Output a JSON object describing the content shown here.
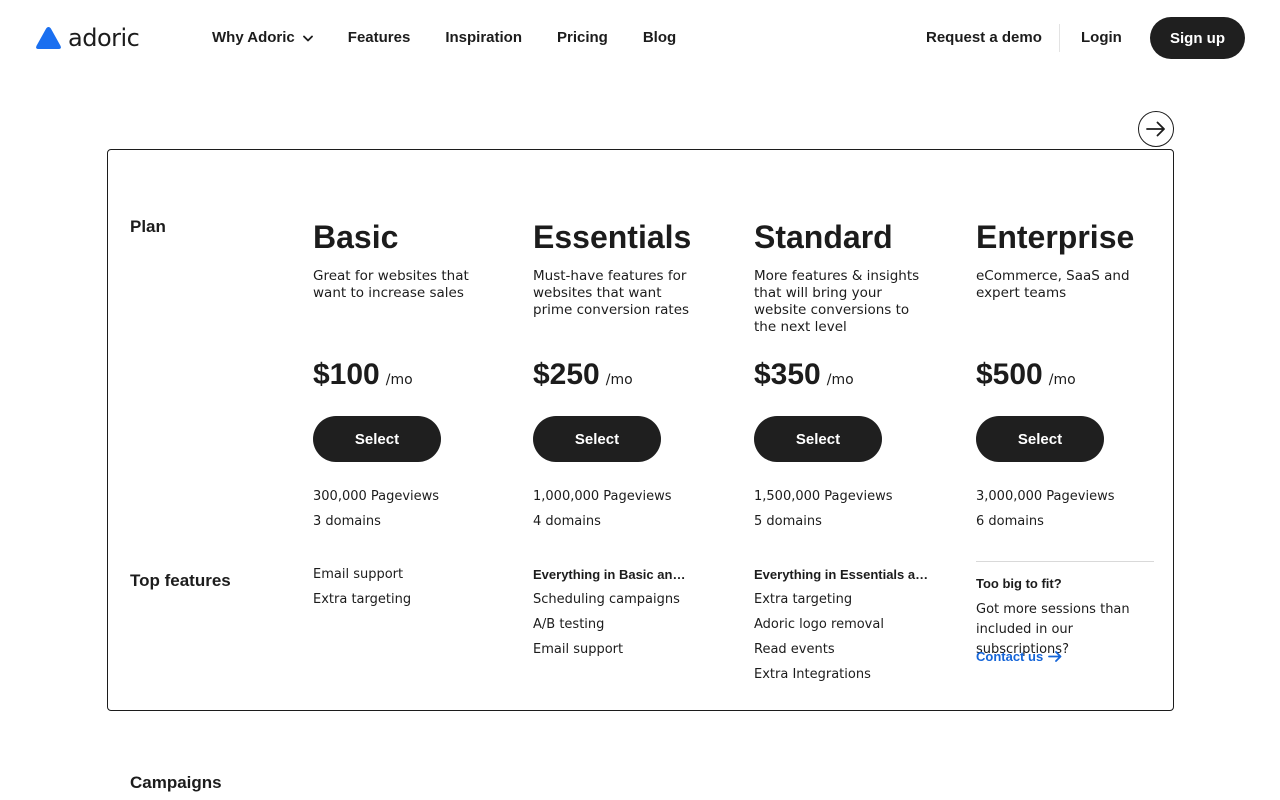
{
  "header": {
    "brand": "adoric",
    "nav": [
      {
        "label": "Why Adoric",
        "has_dropdown": true
      },
      {
        "label": "Features"
      },
      {
        "label": "Inspiration"
      },
      {
        "label": "Pricing"
      },
      {
        "label": "Blog"
      }
    ],
    "request_demo": "Request a demo",
    "login": "Login",
    "signup": "Sign up"
  },
  "colors": {
    "brand_blue": "#1a6ff0",
    "button_dark": "#1f1f1f",
    "link_blue": "#1565d8"
  },
  "pricing": {
    "plan_row_label": "Plan",
    "features_row_label": "Top features",
    "plans": [
      {
        "name": "Basic",
        "description": "Great for websites that want to increase sales",
        "price": "$100",
        "period": "/mo",
        "cta": "Select",
        "pageviews": "300,000 Pageviews",
        "domains": "3 domains",
        "features_heading": "",
        "features": [
          "Email support",
          "Extra targeting"
        ]
      },
      {
        "name": "Essentials",
        "description": "Must-have features for websites that want prime conversion rates",
        "price": "$250",
        "period": "/mo",
        "cta": "Select",
        "pageviews": "1,000,000 Pageviews",
        "domains": "4 domains",
        "features_heading": "Everything in Basic and...",
        "features": [
          "Scheduling campaigns",
          "A/B testing",
          "Email support"
        ]
      },
      {
        "name": "Standard",
        "description": "More features & insights that will bring your website conversions to the next level",
        "price": "$350",
        "period": "/mo",
        "cta": "Select",
        "pageviews": "1,500,000 Pageviews",
        "domains": "5 domains",
        "features_heading": "Everything in Essentials and...",
        "features": [
          "Extra targeting",
          "Adoric logo removal",
          "Read events",
          "Extra Integrations"
        ]
      },
      {
        "name": "Enterprise",
        "description": "eCommerce, SaaS and expert teams",
        "price": "$500",
        "period": "/mo",
        "cta": "Select",
        "pageviews": "3,000,000 Pageviews",
        "domains": "6 domains"
      }
    ],
    "enterprise_box": {
      "title": "Too big to fit?",
      "text": "Got more sessions than included in our subscriptions?",
      "link": "Contact us"
    }
  },
  "next_section_label": "Campaigns"
}
